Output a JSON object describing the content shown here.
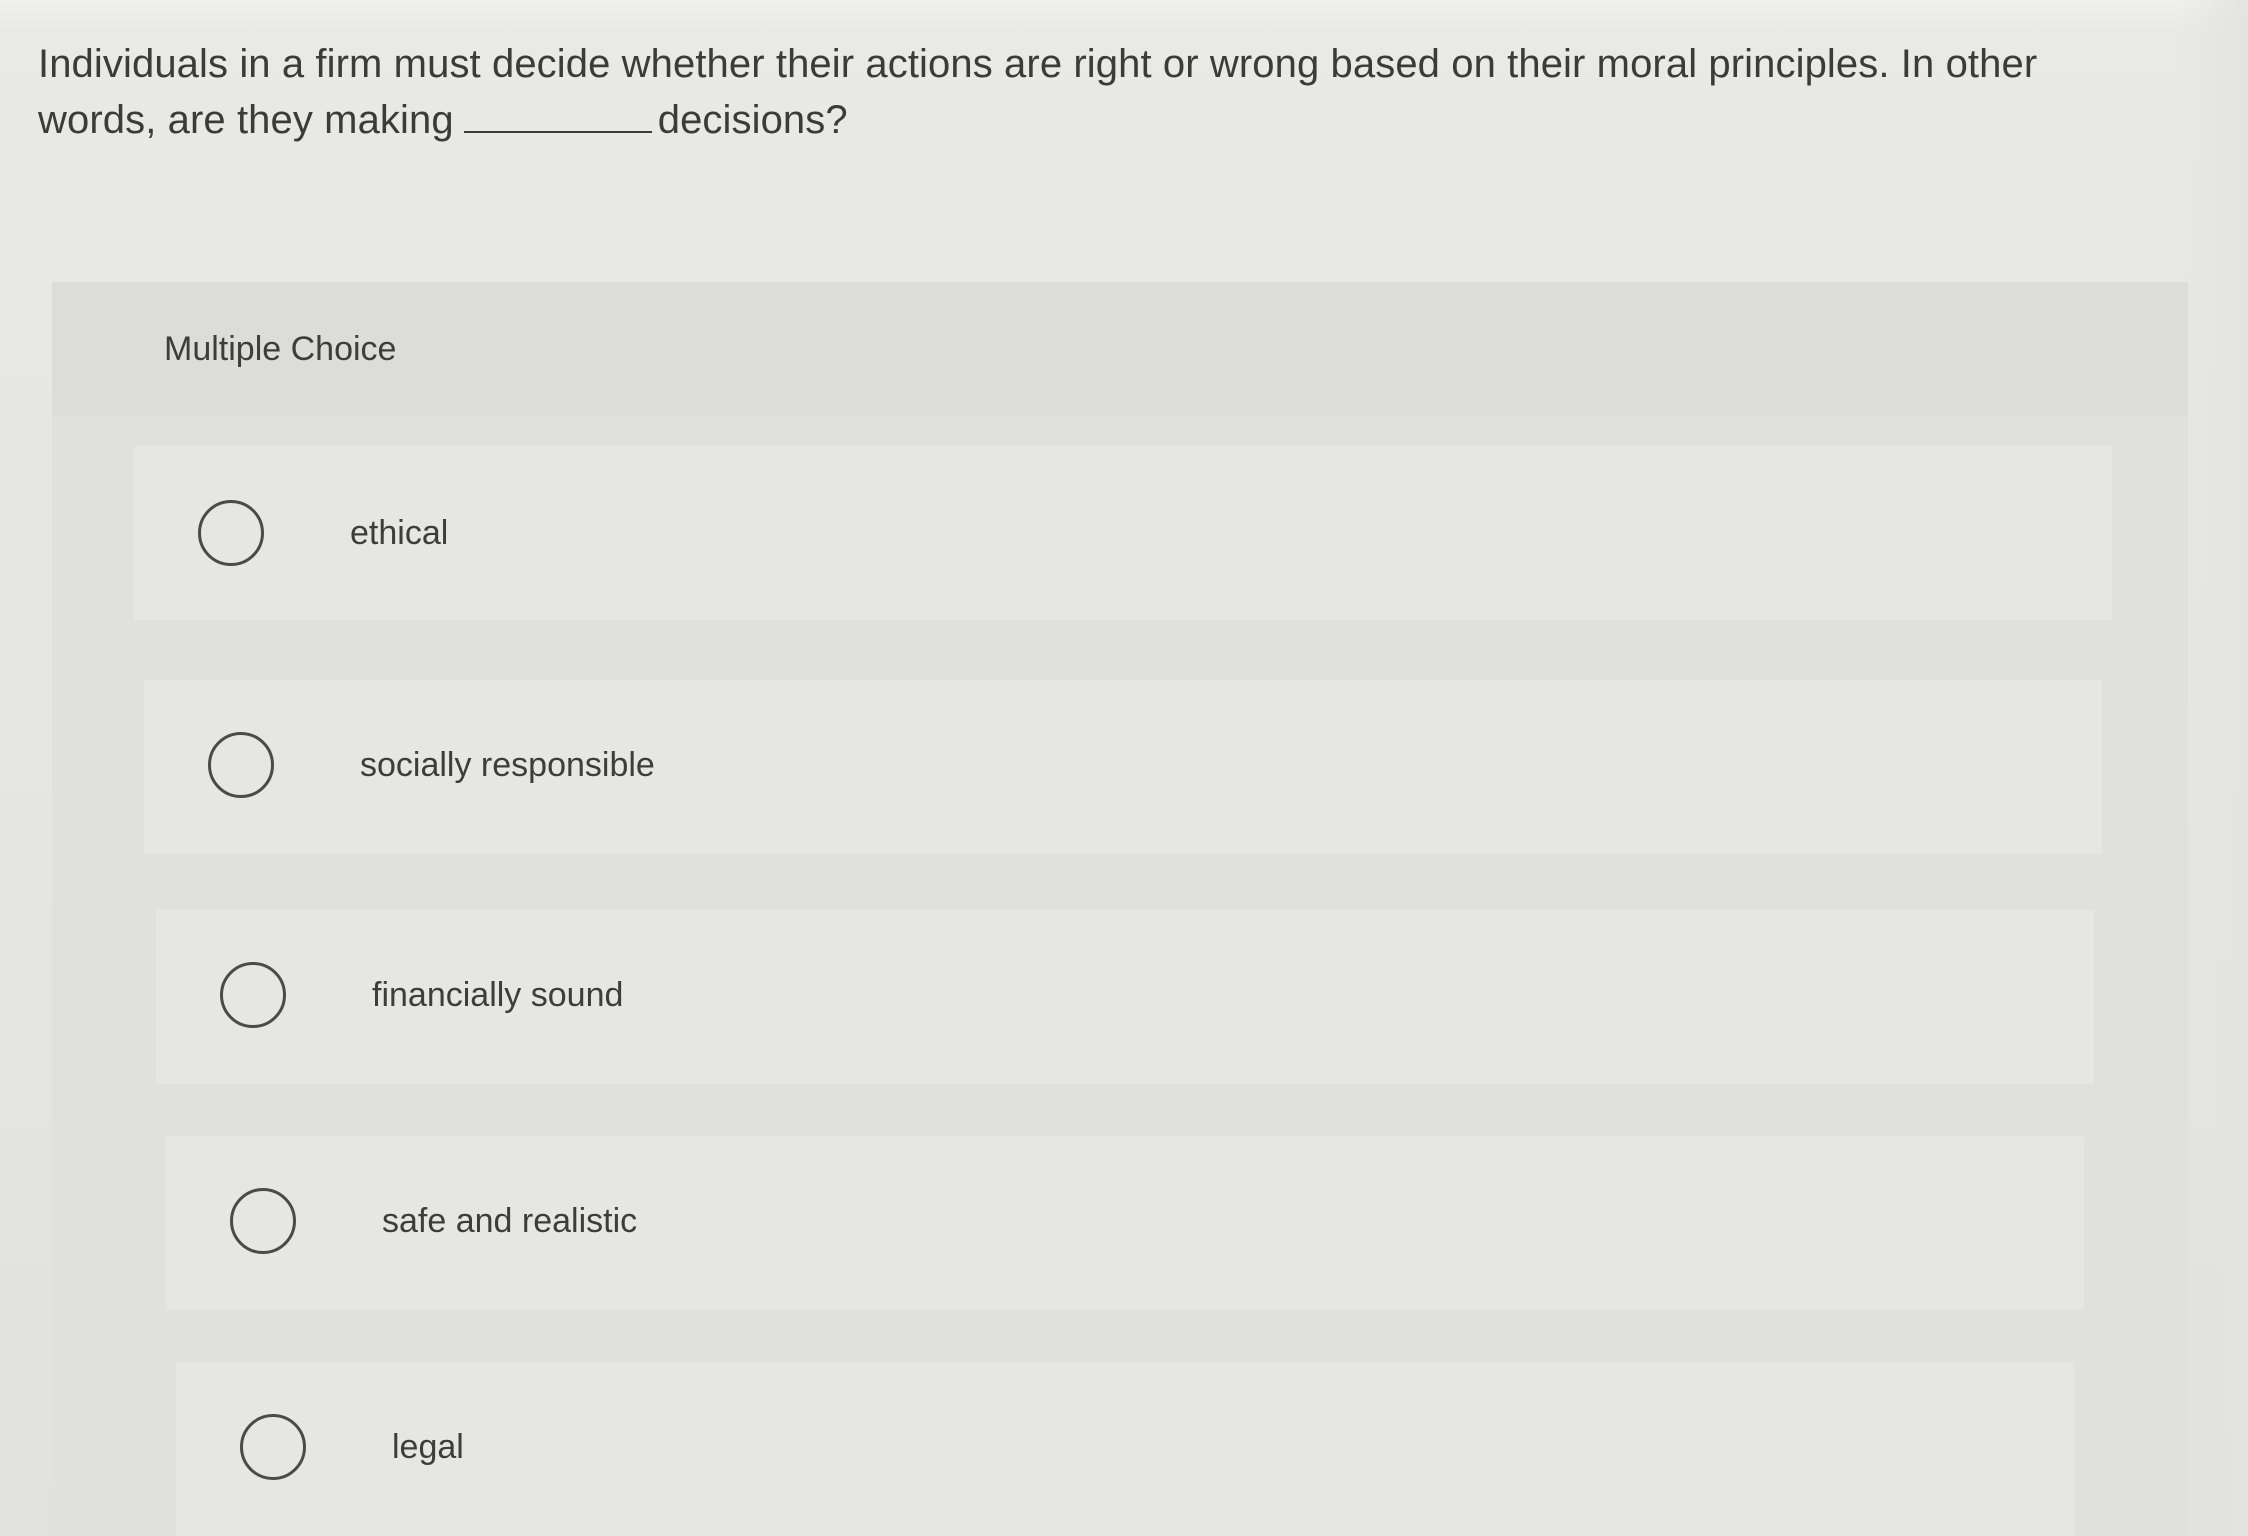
{
  "question": {
    "text_before_blank": "Individuals in a firm must decide whether their actions are right or wrong based on their moral principles. In other words, are they making",
    "text_after_blank": "decisions?"
  },
  "multiple_choice": {
    "label": "Multiple Choice",
    "options": [
      {
        "label": "ethical",
        "selected": false
      },
      {
        "label": "socially responsible",
        "selected": false
      },
      {
        "label": "financially sound",
        "selected": false
      },
      {
        "label": "safe and realistic",
        "selected": false
      },
      {
        "label": "legal",
        "selected": false
      }
    ]
  },
  "icons": {
    "radio": "radio-button-icon"
  }
}
